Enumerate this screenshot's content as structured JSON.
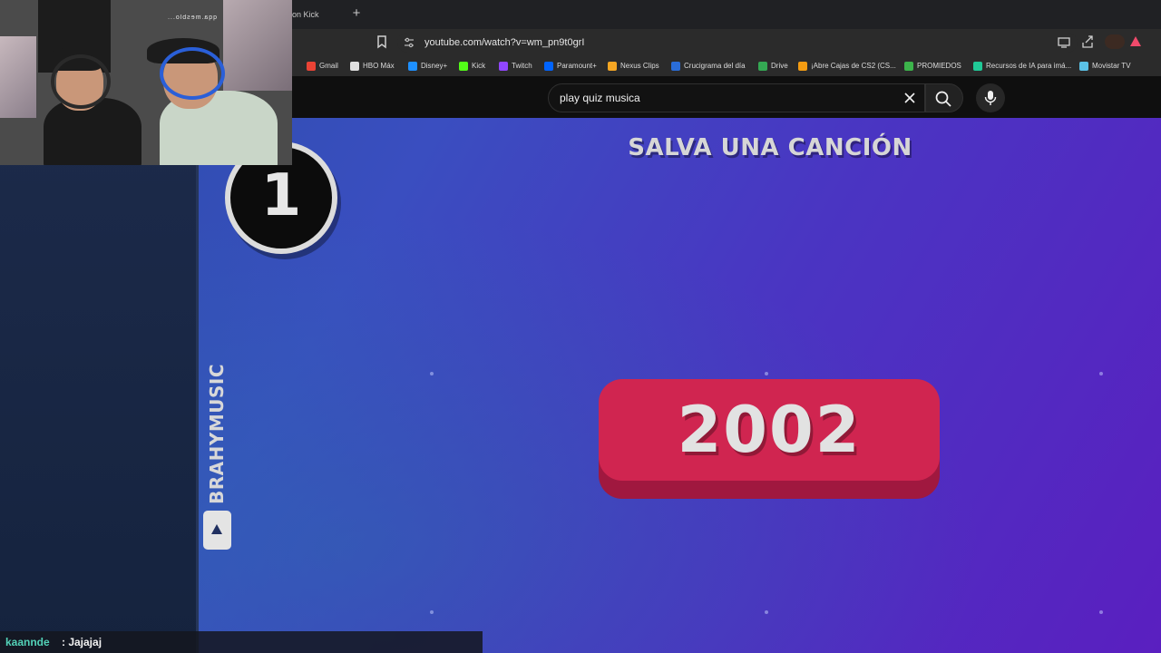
{
  "browser": {
    "tab_title": "on Kick",
    "new_tab_label": "+",
    "url": "youtube.com/watch?v=wm_pn9t0grI",
    "bookmarks": [
      {
        "label": "Gmail",
        "icon": "gmail-icon",
        "color": "#ea4335"
      },
      {
        "label": "HBO Máx",
        "icon": "hbo-icon",
        "color": "#e0e0e0"
      },
      {
        "label": "Disney+",
        "icon": "disney-icon",
        "color": "#1e90ff"
      },
      {
        "label": "Kick",
        "icon": "kick-icon",
        "color": "#53fc18"
      },
      {
        "label": "Twitch",
        "icon": "twitch-icon",
        "color": "#9146ff"
      },
      {
        "label": "Paramount+",
        "icon": "paramount-icon",
        "color": "#0064ff"
      },
      {
        "label": "Nexus Clips",
        "icon": "nexus-icon",
        "color": "#f5a623"
      },
      {
        "label": "Crucigrama del día",
        "icon": "crossword-icon",
        "color": "#2a6dd8"
      },
      {
        "label": "Drive",
        "icon": "drive-icon",
        "color": "#34a853"
      },
      {
        "label": "¡Abre Cajas de CS2 (CS...",
        "icon": "cs2-icon",
        "color": "#f39c12"
      },
      {
        "label": "PROMIEDOS",
        "icon": "promiedos-icon",
        "color": "#3cb44b"
      },
      {
        "label": "Recursos de IA para imá...",
        "icon": "ai-icon",
        "color": "#20c997"
      },
      {
        "label": "Movistar TV",
        "icon": "movistar-icon",
        "color": "#5bc2e7"
      }
    ]
  },
  "youtube": {
    "search_query": "play quiz musica"
  },
  "video": {
    "headline": "SALVA UNA CANCIÓN",
    "number": "1",
    "year": "2002",
    "channel": "BRAHYMUSIC"
  },
  "webcam": {
    "overlay_text": "qqa.mesblo..."
  },
  "chat": {
    "username": "kaannde",
    "separator_message": ": Jajajaj"
  },
  "colors": {
    "accent_red": "#d02550",
    "video_blue": "#3a4ec0",
    "video_purple": "#5a1fc0",
    "chat_user": "#53d2b8"
  }
}
